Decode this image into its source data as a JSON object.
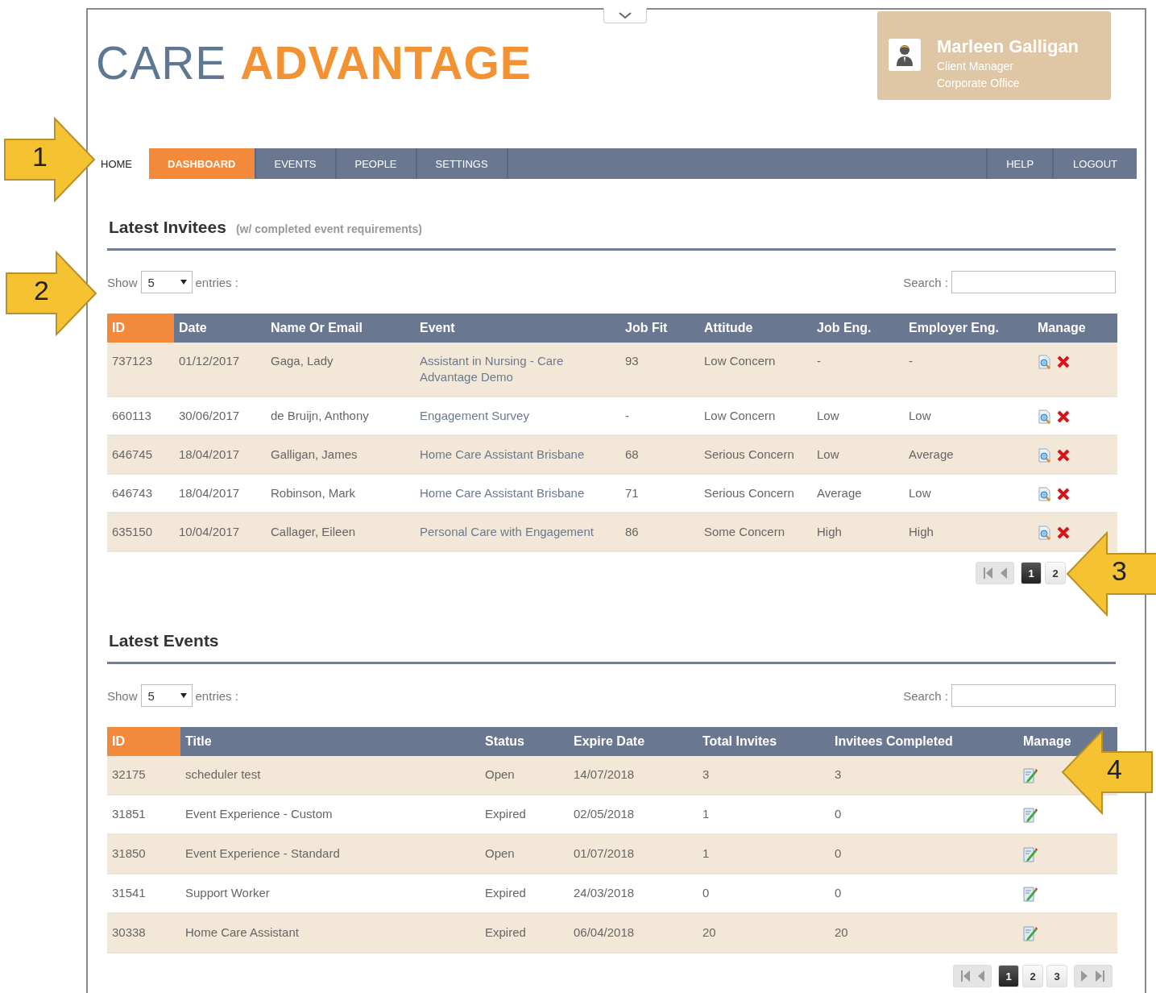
{
  "logo": {
    "part_1": "CARE",
    "part_2": "ADVANTAGE"
  },
  "user": {
    "name": "Marleen Galligan",
    "role": "Client Manager",
    "office": "Corporate Office"
  },
  "home_link": "HOME",
  "nav": [
    {
      "label": "DASHBOARD",
      "selected": true
    },
    {
      "label": "EVENTS",
      "selected": false
    },
    {
      "label": "PEOPLE",
      "selected": false
    },
    {
      "label": "SETTINGS",
      "selected": false
    }
  ],
  "nav_right": [
    "HELP",
    "LOGOUT"
  ],
  "invitees": {
    "title": "Latest Invitees",
    "subtitle": "(w/ completed event requirements)",
    "show_label": "Show",
    "show_value": "5",
    "entries_label": "entries :",
    "search_label": "Search :",
    "columns": [
      "ID",
      "Date",
      "Name Or Email",
      "Event",
      "Job Fit",
      "Attitude",
      "Job Eng.",
      "Employer Eng.",
      "Manage"
    ],
    "rows": [
      {
        "cells": [
          "737123",
          "01/12/2017",
          "Gaga, Lady",
          "Assistant in Nursing - Care Advantage Demo",
          "93",
          "Low Concern",
          "-",
          "-"
        ]
      },
      {
        "cells": [
          "660113",
          "30/06/2017",
          "de Bruijn, Anthony",
          "Engagement Survey",
          "-",
          "Low Concern",
          "Low",
          "Low"
        ]
      },
      {
        "cells": [
          "646745",
          "18/04/2017",
          "Galligan, James",
          "Home Care Assistant Brisbane",
          "68",
          "Serious Concern",
          "Low",
          "Average"
        ]
      },
      {
        "cells": [
          "646743",
          "18/04/2017",
          "Robinson, Mark",
          "Home Care Assistant Brisbane",
          "71",
          "Serious Concern",
          "Average",
          "Low"
        ]
      },
      {
        "cells": [
          "635150",
          "10/04/2017",
          "Callager, Eileen",
          "Personal Care with Engagement",
          "86",
          "Some Concern",
          "High",
          "High"
        ]
      }
    ],
    "pager_before": [
      {
        "kind": "first_prev"
      }
    ],
    "pages": [
      {
        "label": "1",
        "selected": true
      },
      {
        "label": "2",
        "selected": false
      }
    ]
  },
  "events": {
    "title": "Latest Events",
    "show_label": "Show",
    "show_value": "5",
    "entries_label": "entries :",
    "search_label": "Search :",
    "columns": [
      "ID",
      "Title",
      "Status",
      "Expire Date",
      "Total Invites",
      "Invitees Completed",
      "Manage"
    ],
    "rows": [
      {
        "cells": [
          "32175",
          "scheduler test",
          "Open",
          "14/07/2018",
          "3",
          "3"
        ]
      },
      {
        "cells": [
          "31851",
          "Event Experience - Custom",
          "Expired",
          "02/05/2018",
          "1",
          "0"
        ]
      },
      {
        "cells": [
          "31850",
          "Event Experience - Standard",
          "Open",
          "01/07/2018",
          "1",
          "0"
        ]
      },
      {
        "cells": [
          "31541",
          "Support Worker",
          "Expired",
          "24/03/2018",
          "0",
          "0"
        ]
      },
      {
        "cells": [
          "30338",
          "Home Care Assistant",
          "Expired",
          "06/04/2018",
          "20",
          "20"
        ]
      }
    ],
    "pager_before": [
      {
        "kind": "first_prev"
      }
    ],
    "pages": [
      {
        "label": "1",
        "selected": true
      },
      {
        "label": "2",
        "selected": false
      },
      {
        "label": "3",
        "selected": false
      }
    ],
    "pager_after": [
      {
        "kind": "next_last"
      }
    ]
  },
  "callouts": [
    {
      "label": "1",
      "kind": "right"
    },
    {
      "label": "2",
      "kind": "right"
    },
    {
      "label": "3",
      "kind": "left"
    },
    {
      "label": "4",
      "kind": "left"
    }
  ]
}
